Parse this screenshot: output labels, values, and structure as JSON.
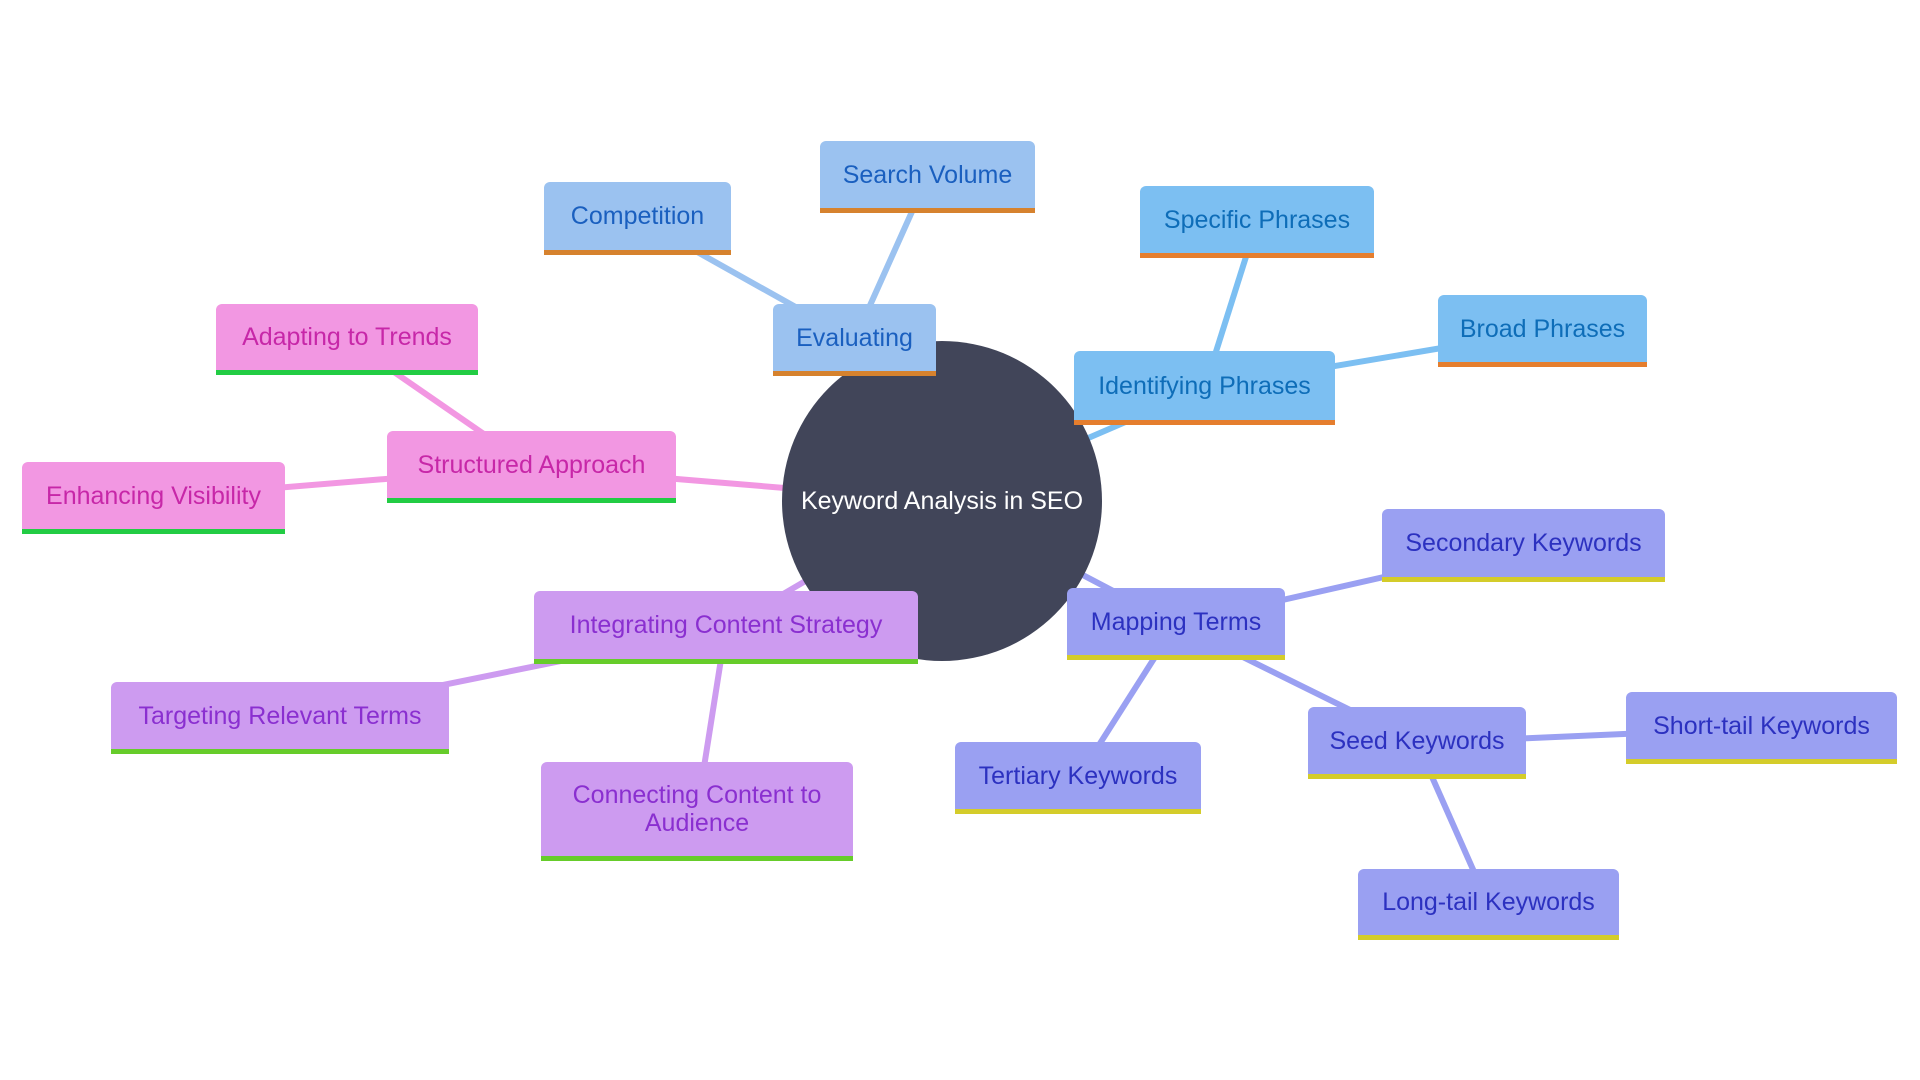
{
  "diagram": {
    "type": "mindmap",
    "root": {
      "id": "root",
      "label": "Keyword Analysis in SEO",
      "color": "#414559"
    },
    "branches": [
      {
        "id": "eval",
        "label": "Evaluating",
        "color": "#9bc2f0",
        "edge_color": "#9bc2f0",
        "children": [
          {
            "id": "comp",
            "label": "Competition"
          },
          {
            "id": "search",
            "label": "Search Volume"
          }
        ]
      },
      {
        "id": "ident",
        "label": "Identifying Phrases",
        "color": "#7cbff2",
        "edge_color": "#7cbff2",
        "children": [
          {
            "id": "spec",
            "label": "Specific Phrases"
          },
          {
            "id": "broad",
            "label": "Broad Phrases"
          }
        ]
      },
      {
        "id": "struct",
        "label": "Structured Approach",
        "color": "#f297e2",
        "edge_color": "#f297e2",
        "children": [
          {
            "id": "adapt",
            "label": "Adapting to Trends"
          },
          {
            "id": "enh",
            "label": "Enhancing Visibility"
          }
        ]
      },
      {
        "id": "integ",
        "label": "Integrating Content Strategy",
        "color": "#cd9bf0",
        "edge_color": "#cd9bf0",
        "children": [
          {
            "id": "target",
            "label": "Targeting Relevant Terms"
          },
          {
            "id": "conn",
            "label": "Connecting Content to Audience",
            "lines": [
              "Connecting Content to",
              "Audience"
            ]
          }
        ]
      },
      {
        "id": "map",
        "label": "Mapping Terms",
        "color": "#9aa0f2",
        "edge_color": "#9aa0f2",
        "children": [
          {
            "id": "sec",
            "label": "Secondary Keywords"
          },
          {
            "id": "tert",
            "label": "Tertiary Keywords"
          },
          {
            "id": "seed",
            "label": "Seed Keywords",
            "children": [
              {
                "id": "short",
                "label": "Short-tail Keywords"
              },
              {
                "id": "long",
                "label": "Long-tail Keywords"
              }
            ]
          }
        ]
      }
    ]
  }
}
